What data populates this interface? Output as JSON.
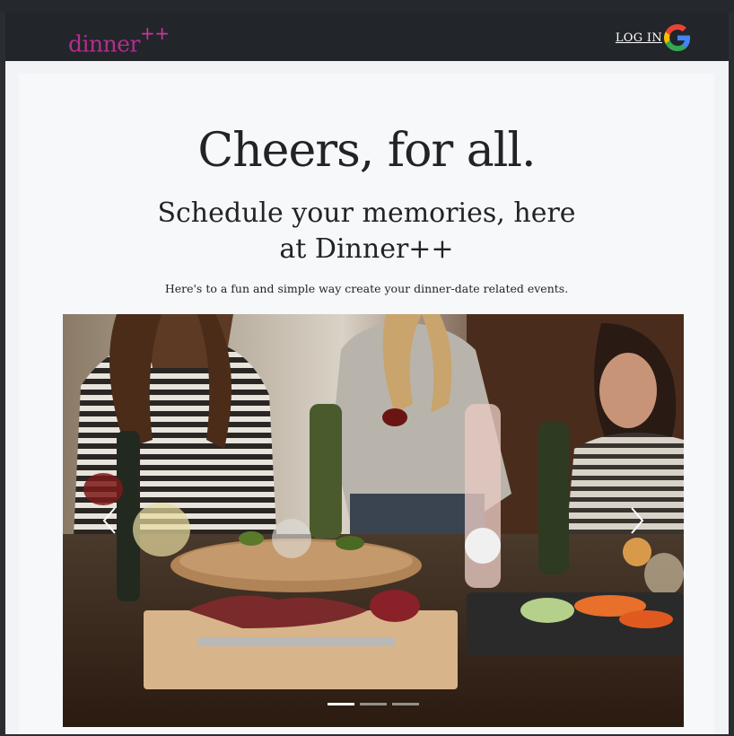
{
  "navbar": {
    "brand": "dinner",
    "brand_suffix": "++",
    "login_label": "LOG IN",
    "google_icon": "google-icon"
  },
  "hero": {
    "headline": "Cheers, for all.",
    "subhead_line1": "Schedule your memories, here",
    "subhead_line2": "at Dinner++",
    "tagline": "Here's to a fun and simple way create your dinner-date related events."
  },
  "carousel": {
    "prev_icon": "chevron-left-icon",
    "next_icon": "chevron-right-icon",
    "slide_count": 3,
    "active_slide": 1
  },
  "colors": {
    "brand": "#b42e8e",
    "navbar": "#22252a",
    "page": "#f7f8fa",
    "text": "#222326"
  }
}
